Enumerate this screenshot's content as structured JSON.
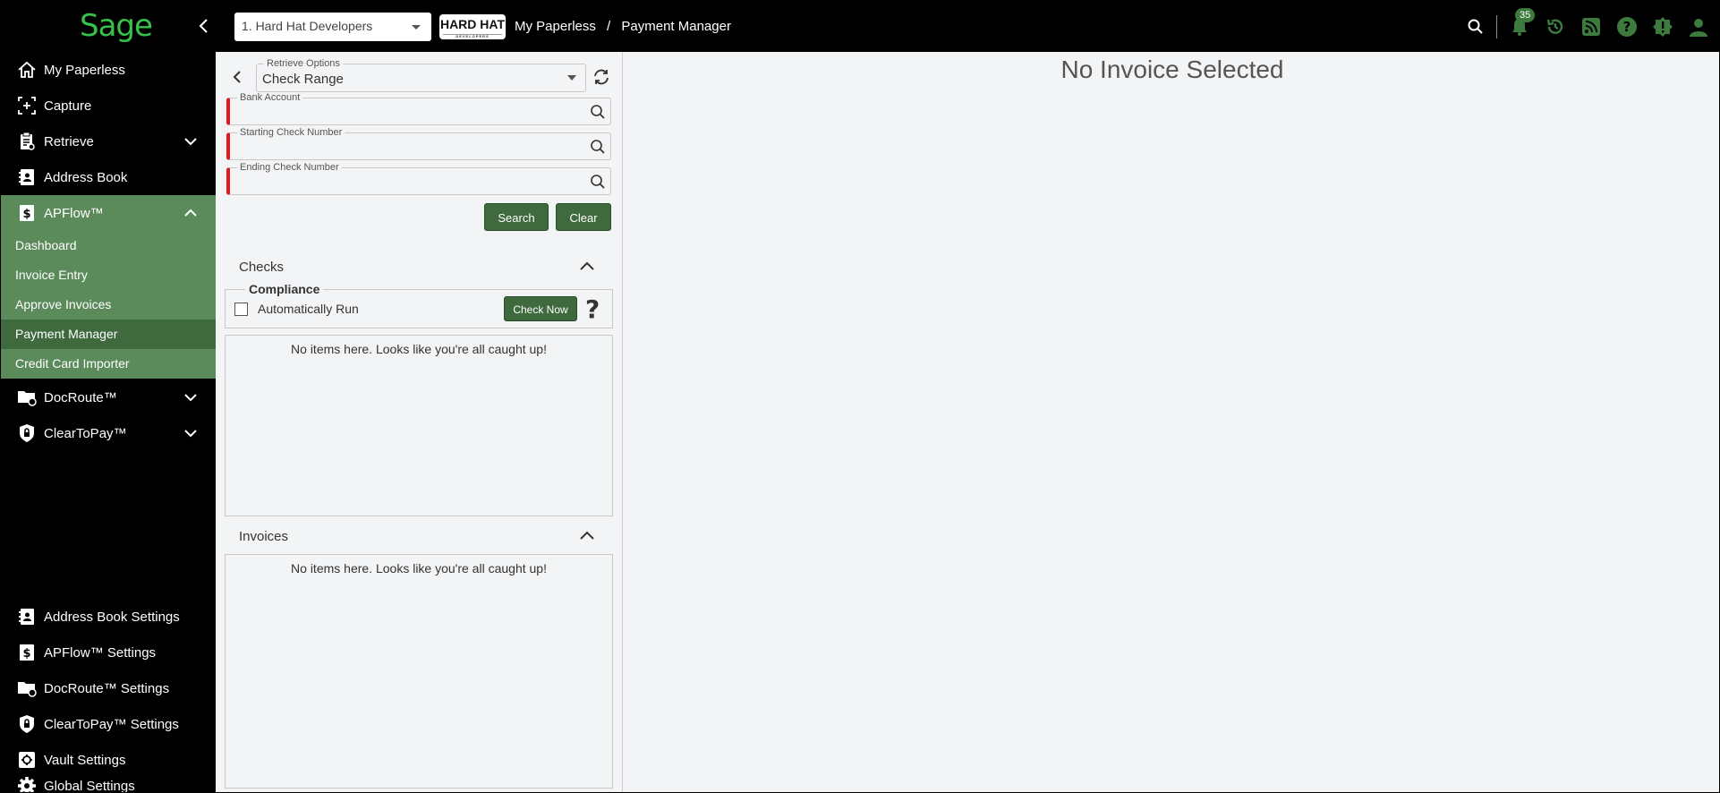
{
  "topbar": {
    "logo": "Sage",
    "company": "1. Hard Hat Developers",
    "company_logo": "HARD HAT",
    "company_logo_sub": "DEVELOPERS",
    "breadcrumb": [
      "My Paperless",
      "/",
      "Payment Manager"
    ],
    "notification_count": "35",
    "icons": [
      "search-icon",
      "bell-icon",
      "history-icon",
      "rss-icon",
      "help-icon",
      "alert-badge-icon",
      "user-icon"
    ]
  },
  "sidebar": {
    "items": [
      {
        "label": "My Paperless",
        "icon": "home-icon"
      },
      {
        "label": "Capture",
        "icon": "capture-icon"
      },
      {
        "label": "Retrieve",
        "icon": "clipboard-icon"
      },
      {
        "label": "Address Book",
        "icon": "address-book-icon"
      },
      {
        "label": "APFlow™",
        "icon": "dollar-icon"
      },
      {
        "label": "DocRoute™",
        "icon": "folder-icon"
      },
      {
        "label": "ClearToPay™",
        "icon": "shield-icon"
      }
    ],
    "apflow_sub": [
      "Dashboard",
      "Invoice Entry",
      "Approve Invoices",
      "Payment Manager",
      "Credit Card Importer"
    ],
    "settings": [
      {
        "label": "Address Book Settings",
        "icon": "address-book-icon"
      },
      {
        "label": "APFlow™ Settings",
        "icon": "dollar-icon"
      },
      {
        "label": "DocRoute™ Settings",
        "icon": "folder-icon"
      },
      {
        "label": "ClearToPay™ Settings",
        "icon": "shield-icon"
      },
      {
        "label": "Vault Settings",
        "icon": "vault-icon"
      },
      {
        "label": "Global Settings",
        "icon": "gear-icon"
      }
    ]
  },
  "panel": {
    "retrieve_label": "Retrieve Options",
    "retrieve_value": "Check Range",
    "bank_account_label": "Bank Account",
    "start_check_label": "Starting Check Number",
    "end_check_label": "Ending Check Number",
    "search_button": "Search",
    "clear_button": "Clear",
    "checks_title": "Checks",
    "compliance_title": "Compliance",
    "auto_run_label": "Automatically Run",
    "check_now_button": "Check Now",
    "help_glyph": "?",
    "checks_empty": "No items here. Looks like you're all caught up!",
    "invoices_title": "Invoices",
    "invoices_empty": "No items here. Looks like you're all caught up!"
  },
  "main": {
    "title": "No Invoice Selected"
  },
  "colors": {
    "brand_green": "#36c24a",
    "nav_expanded": "#5b8a5b",
    "nav_active": "#3e6a3e",
    "button": "#3e6a3e",
    "required": "#e01a1a"
  }
}
